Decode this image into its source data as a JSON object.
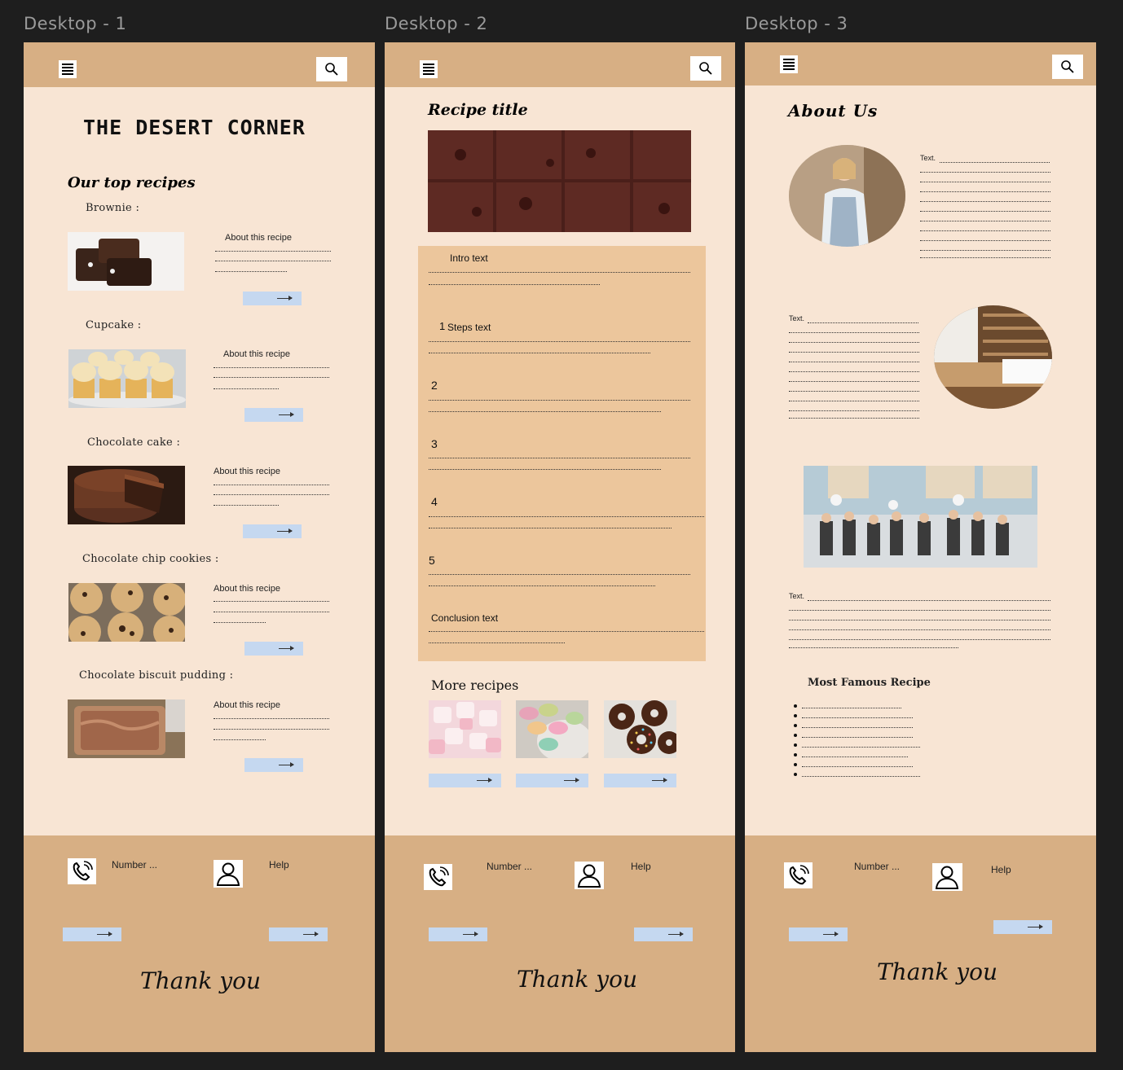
{
  "frames": [
    {
      "label": "Desktop - 1"
    },
    {
      "label": "Desktop - 2"
    },
    {
      "label": "Desktop - 3"
    }
  ],
  "home": {
    "brand": "THE DESERT CORNER",
    "section_title": "Our top recipes",
    "about_label": "About this recipe",
    "recipes": [
      {
        "name": "Brownie :"
      },
      {
        "name": "Cupcake :"
      },
      {
        "name": "Chocolate cake :"
      },
      {
        "name": "Chocolate chip cookies :"
      },
      {
        "name": "Chocolate biscuit pudding :"
      }
    ]
  },
  "recipe": {
    "title": "Recipe title",
    "intro": "Intro text",
    "steps": [
      {
        "num": "1",
        "text": "Steps text"
      },
      {
        "num": "2",
        "text": ""
      },
      {
        "num": "3",
        "text": ""
      },
      {
        "num": "4",
        "text": ""
      },
      {
        "num": "5",
        "text": ""
      }
    ],
    "conclusion": "Conclusion text",
    "more_title": "More recipes"
  },
  "about": {
    "title": "About Us",
    "text_label": "Text.",
    "famous_title": "Most Famous Recipe"
  },
  "footer": {
    "number_label": "Number ...",
    "help_label": "Help",
    "thank_you": "Thank you"
  },
  "icons": {
    "menu": "menu-icon",
    "search": "search-icon",
    "phone": "phone-icon",
    "user": "user-icon",
    "arrow": "arrow-right-icon"
  },
  "colors": {
    "header": "#d7af84",
    "page": "#f8e5d4",
    "panel": "#ecc69c",
    "button": "#c5d8f0",
    "canvas": "#1e1e1e"
  }
}
